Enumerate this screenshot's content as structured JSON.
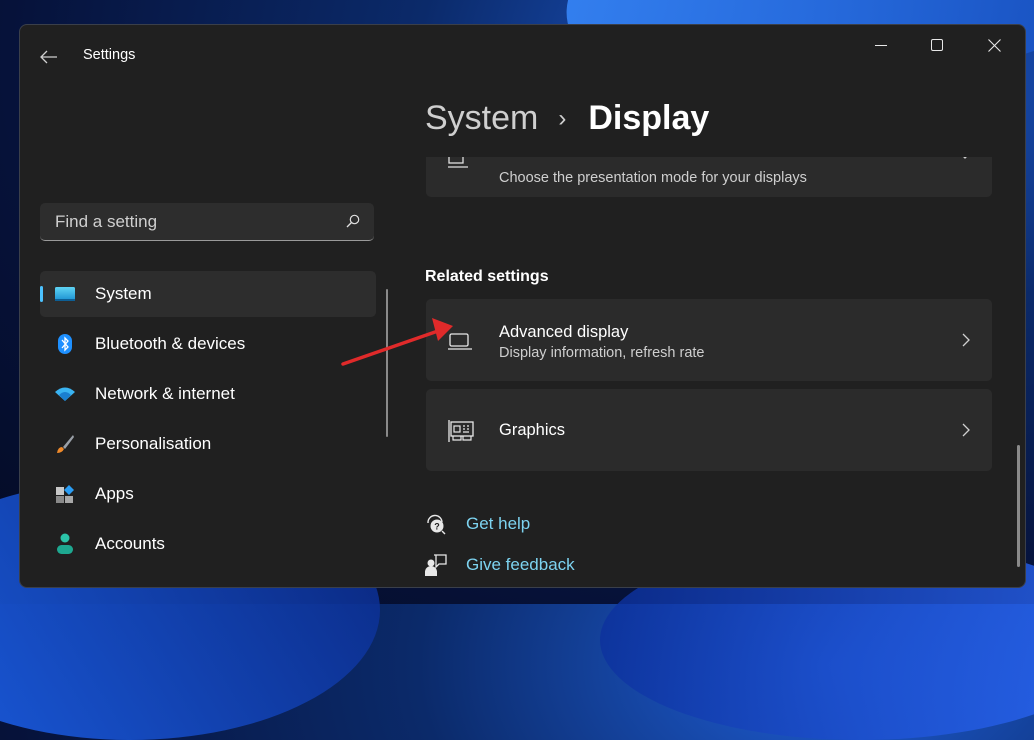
{
  "window": {
    "app_title": "Settings",
    "back_icon": "back-arrow-icon",
    "controls": {
      "minimize": "minimize-icon",
      "maximize": "maximize-icon",
      "close": "close-icon"
    }
  },
  "search": {
    "placeholder": "Find a setting",
    "value": "",
    "icon": "search-icon"
  },
  "sidebar": {
    "items": [
      {
        "label": "System",
        "icon": "system-monitor-icon",
        "active": true
      },
      {
        "label": "Bluetooth & devices",
        "icon": "bluetooth-icon",
        "active": false
      },
      {
        "label": "Network & internet",
        "icon": "wifi-icon",
        "active": false
      },
      {
        "label": "Personalisation",
        "icon": "paintbrush-icon",
        "active": false
      },
      {
        "label": "Apps",
        "icon": "apps-icon",
        "active": false
      },
      {
        "label": "Accounts",
        "icon": "account-person-icon",
        "active": false
      }
    ]
  },
  "breadcrumb": {
    "parent": "System",
    "separator": "›",
    "current": "Display"
  },
  "main": {
    "partial_card": {
      "description": "Choose the presentation mode for your displays",
      "icon": "multiple-displays-icon",
      "control_icon": "chevron-down-icon"
    },
    "related_settings": {
      "heading": "Related settings",
      "items": [
        {
          "title": "Advanced display",
          "description": "Display information, refresh rate",
          "icon": "laptop-icon"
        },
        {
          "title": "Graphics",
          "description": "",
          "icon": "graphics-card-icon"
        }
      ]
    },
    "links": [
      {
        "label": "Get help",
        "icon": "help-chat-icon"
      },
      {
        "label": "Give feedback",
        "icon": "feedback-icon"
      }
    ]
  },
  "colors": {
    "accent": "#4cc2ff",
    "link": "#7dd3f0",
    "window_bg": "#202020",
    "card_bg": "#2b2b2b",
    "annotation_arrow": "#e02a2a"
  }
}
